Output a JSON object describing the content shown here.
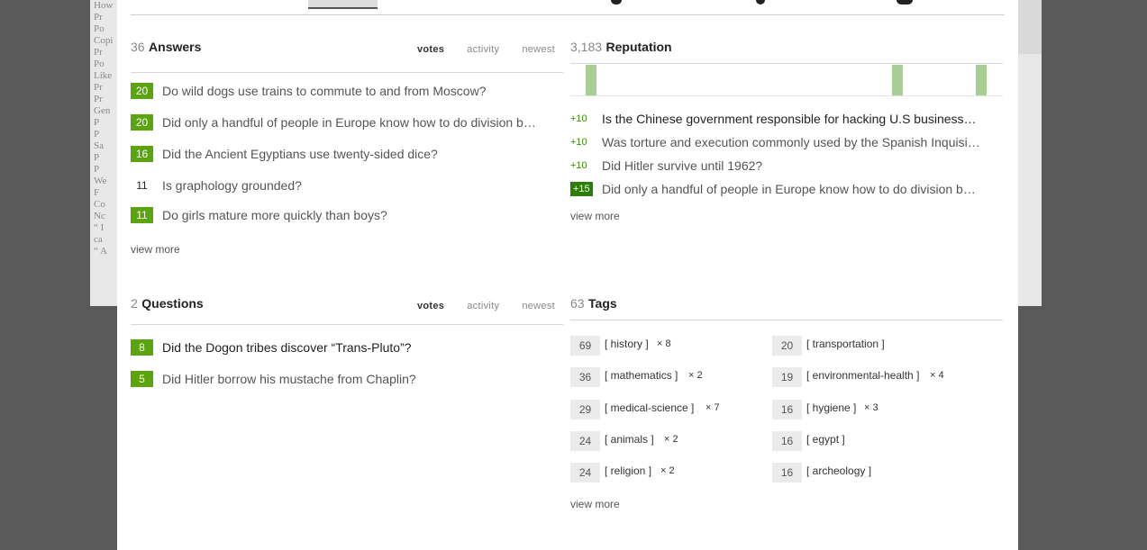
{
  "background_page": {
    "lines": [
      "How",
      "Pr",
      "Po",
      "Copi",
      "Pr",
      "Po",
      "Like",
      "Pr",
      "Pr",
      "Gen",
      "P",
      "P",
      "",
      "Sa",
      "P",
      "P",
      "We",
      "F",
      "Co",
      "",
      "Nc",
      "“ I",
      "ca",
      "“ A"
    ]
  },
  "answers": {
    "count": "36",
    "title": "Answers",
    "sorts": [
      "votes",
      "activity",
      "newest"
    ],
    "items": [
      {
        "score": "20",
        "text": "Do wild dogs use trains to commute to and from Moscow?",
        "highlight": true
      },
      {
        "score": "20",
        "text": "Did only a handful of people in Europe know how to do division b…",
        "highlight": true
      },
      {
        "score": "16",
        "text": "Did the Ancient Egyptians use twenty-sided dice?",
        "highlight": true
      },
      {
        "score": "11",
        "text": "Is graphology grounded?",
        "highlight": false
      },
      {
        "score": "11",
        "text": "Do girls mature more quickly than boys?",
        "highlight": true
      }
    ],
    "view_more": "view more"
  },
  "reputation": {
    "count": "3,183",
    "title": "Reputation",
    "sparkline_bar_count": 3,
    "items": [
      {
        "delta": "+10",
        "text": "Is the Chinese government responsible for hacking U.S business…",
        "boxed": false,
        "dark": true
      },
      {
        "delta": "+10",
        "text": "Was torture and execution commonly used by the Spanish Inquisit…",
        "boxed": false,
        "dark": false
      },
      {
        "delta": "+10",
        "text": "Did Hitler survive until 1962?",
        "boxed": false,
        "dark": false
      },
      {
        "delta": "+15",
        "text": "Did only a handful of people in Europe know how to do division b…",
        "boxed": true,
        "dark": false
      }
    ],
    "view_more": "view more"
  },
  "questions": {
    "count": "2",
    "title": "Questions",
    "sorts": [
      "votes",
      "activity",
      "newest"
    ],
    "items": [
      {
        "score": "8",
        "text": "Did the Dogon tribes discover “Trans-Pluto”?",
        "dark": true
      },
      {
        "score": "5",
        "text": "Did Hitler borrow his mustache from Chaplin?",
        "dark": false
      }
    ]
  },
  "tags": {
    "count": "63",
    "title": "Tags",
    "left": [
      {
        "score": "69",
        "name": "[ history ]",
        "mult": "× 8"
      },
      {
        "score": "36",
        "name": "[ mathematics ]",
        "mult": "× 2"
      },
      {
        "score": "29",
        "name": "[ medical-science ]",
        "mult": "× 7"
      },
      {
        "score": "24",
        "name": "[ animals ]",
        "mult": "× 2"
      },
      {
        "score": "24",
        "name": "[ religion ]",
        "mult": "× 2"
      }
    ],
    "right": [
      {
        "score": "20",
        "name": "[ transportation ]",
        "mult": ""
      },
      {
        "score": "19",
        "name": "[ environmental-health ]",
        "mult": "× 4"
      },
      {
        "score": "16",
        "name": "[ hygiene ]",
        "mult": "× 3"
      },
      {
        "score": "16",
        "name": "[ egypt ]",
        "mult": ""
      },
      {
        "score": "16",
        "name": "[ archeology ]",
        "mult": ""
      }
    ],
    "view_more": "view more"
  },
  "colors": {
    "score_green": "#5aa40d",
    "rep_green": "#3a8a0a",
    "rep_box": "#2e7d08",
    "spark_bar": "#a8cf93",
    "overlay": "#5a5a5a"
  }
}
